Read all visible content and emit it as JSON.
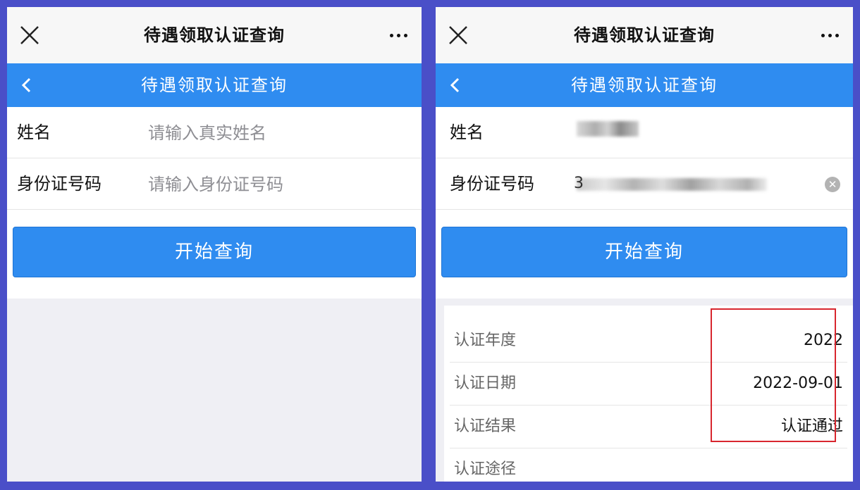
{
  "left": {
    "topbar_title": "待遇领取认证查询",
    "header_title": "待遇领取认证查询",
    "form": {
      "name_label": "姓名",
      "name_placeholder": "请输入真实姓名",
      "id_label": "身份证号码",
      "id_placeholder": "请输入身份证号码"
    },
    "query_button": "开始查询"
  },
  "right": {
    "topbar_title": "待遇领取认证查询",
    "header_title": "待遇领取认证查询",
    "form": {
      "name_label": "姓名",
      "id_label": "身份证号码",
      "id_prefix": "3"
    },
    "query_button": "开始查询",
    "results": [
      {
        "label": "认证年度",
        "value": "2022"
      },
      {
        "label": "认证日期",
        "value": "2022-09-01"
      },
      {
        "label": "认证结果",
        "value": "认证通过"
      },
      {
        "label": "认证途径",
        "value": ""
      }
    ]
  },
  "colors": {
    "accent": "#2f8cf0",
    "frame": "#4a4fc8",
    "highlight": "#d8262e"
  },
  "icons": {
    "close": "close-icon",
    "more": "more-icon",
    "back": "chevron-left-icon",
    "clear": "clear-icon"
  }
}
